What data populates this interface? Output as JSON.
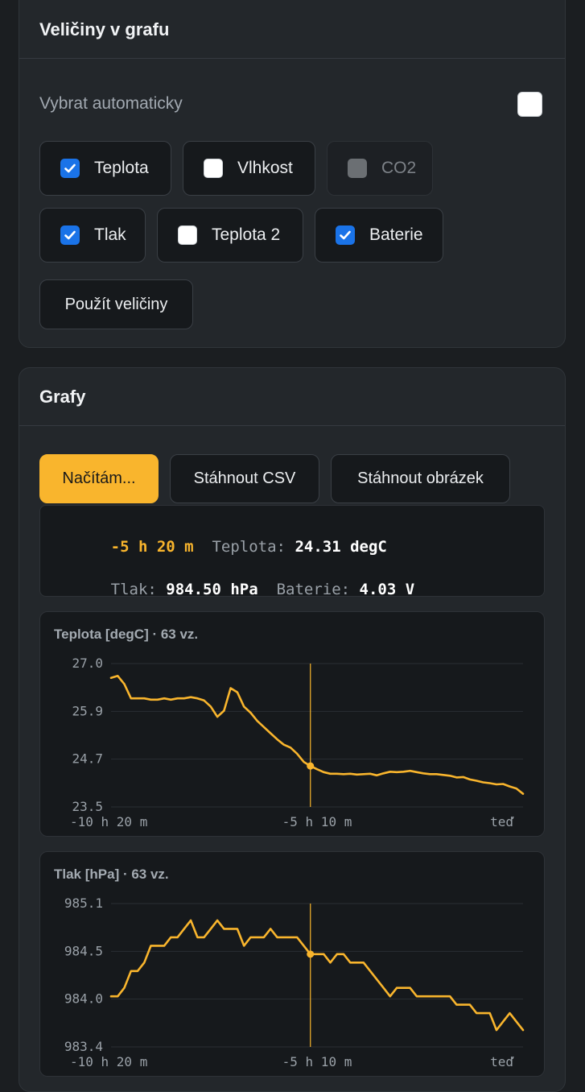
{
  "quantities_section": {
    "title": "Veličiny v grafu",
    "auto_select_label": "Vybrat automaticky",
    "auto_select_checked": false,
    "options": [
      {
        "label": "Teplota",
        "checked": true,
        "disabled": false
      },
      {
        "label": "Vlhkost",
        "checked": false,
        "disabled": false
      },
      {
        "label": "CO2",
        "checked": false,
        "disabled": true
      },
      {
        "label": "Tlak",
        "checked": true,
        "disabled": false
      },
      {
        "label": "Teplota 2",
        "checked": false,
        "disabled": false
      },
      {
        "label": "Baterie",
        "checked": true,
        "disabled": false
      }
    ],
    "apply_label": "Použít veličiny"
  },
  "graphs_section": {
    "title": "Grafy",
    "buttons": {
      "loading": "Načítám...",
      "download_csv": "Stáhnout CSV",
      "download_image": "Stáhnout obrázek"
    },
    "readout": {
      "time": "-5 h 20 m",
      "temp_label": "Teplota:",
      "temp_value": "24.31 degC",
      "pressure_label": "Tlak:",
      "pressure_value": "984.50 hPa",
      "battery_label": "Baterie:",
      "battery_value": "4.03 V"
    }
  },
  "colors": {
    "accent": "#f9b52d",
    "checkbox_checked": "#1a73e8",
    "card_bg": "#23272b",
    "page_bg": "#1b1e21"
  },
  "icons": [
    "checkmark-icon"
  ],
  "chart_data": [
    {
      "type": "line",
      "title": "Teplota [degC] · 63 vz.",
      "ylim": [
        23.5,
        27.0
      ],
      "yticks": [
        "27.0",
        "25.9",
        "24.7",
        "23.5"
      ],
      "xticks": [
        "-10 h 20 m",
        "-5 h 10 m",
        "teď"
      ],
      "grid": true,
      "cursor_index": 30,
      "series": [
        {
          "values": [
            26.65,
            26.7,
            26.5,
            26.15,
            26.15,
            26.15,
            26.12,
            26.12,
            26.15,
            26.12,
            26.15,
            26.15,
            26.18,
            26.15,
            26.1,
            25.95,
            25.7,
            25.85,
            26.4,
            26.3,
            25.95,
            25.8,
            25.6,
            25.45,
            25.3,
            25.15,
            25.02,
            24.95,
            24.8,
            24.6,
            24.5,
            24.42,
            24.35,
            24.31,
            24.31,
            24.3,
            24.31,
            24.29,
            24.3,
            24.31,
            24.27,
            24.32,
            24.36,
            24.35,
            24.36,
            24.38,
            24.35,
            24.32,
            24.3,
            24.3,
            24.28,
            24.26,
            24.22,
            24.23,
            24.17,
            24.14,
            24.1,
            24.08,
            24.05,
            24.06,
            24.0,
            23.95,
            23.82
          ]
        }
      ]
    },
    {
      "type": "line",
      "title": "Tlak [hPa] · 63 vz.",
      "ylim": [
        983.4,
        985.1
      ],
      "yticks": [
        "985.1",
        "984.5",
        "984.0",
        "983.4"
      ],
      "xticks": [
        "-10 h 20 m",
        "-5 h 10 m",
        "teď"
      ],
      "grid": true,
      "cursor_index": 30,
      "series": [
        {
          "values": [
            984.0,
            984.0,
            984.1,
            984.3,
            984.3,
            984.4,
            984.6,
            984.6,
            984.6,
            984.7,
            984.7,
            984.8,
            984.9,
            984.7,
            984.7,
            984.8,
            984.9,
            984.8,
            984.8,
            984.8,
            984.6,
            984.7,
            984.7,
            984.7,
            984.8,
            984.7,
            984.7,
            984.7,
            984.7,
            984.6,
            984.5,
            984.5,
            984.5,
            984.4,
            984.5,
            984.5,
            984.4,
            984.4,
            984.4,
            984.3,
            984.2,
            984.1,
            984.0,
            984.1,
            984.1,
            984.1,
            984.0,
            984.0,
            984.0,
            984.0,
            984.0,
            984.0,
            983.9,
            983.9,
            983.9,
            983.8,
            983.8,
            983.8,
            983.6,
            983.7,
            983.8,
            983.7,
            983.6
          ]
        }
      ]
    }
  ]
}
